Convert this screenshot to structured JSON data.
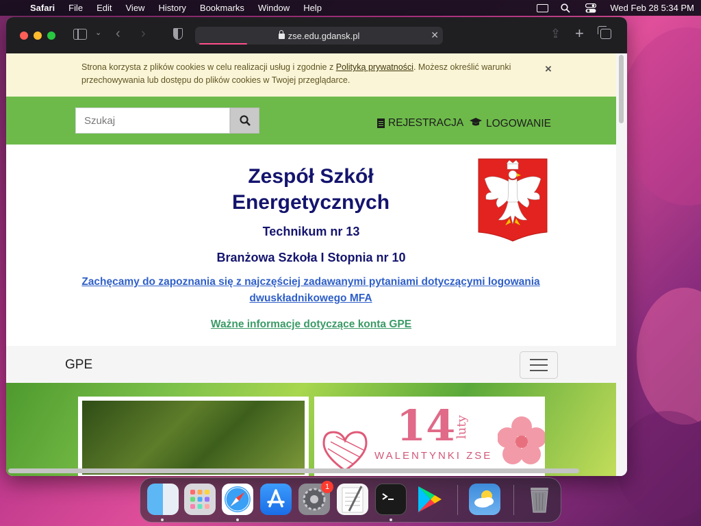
{
  "menubar": {
    "app_name": "Safari",
    "items": [
      "File",
      "Edit",
      "View",
      "History",
      "Bookmarks",
      "Window",
      "Help"
    ],
    "datetime": "Wed Feb 28  5:34 PM"
  },
  "browser": {
    "url": "zse.edu.gdansk.pl"
  },
  "cookie_banner": {
    "text_before": "Strona korzysta z plików cookies w celu realizacji usług i zgodnie z ",
    "link": "Polityką prywatności",
    "text_after": ". Możesz określić warunki przechowywania lub dostępu do plików cookies w Twojej przeglądarce.",
    "close": "×"
  },
  "topbar": {
    "search_placeholder": "Szukaj",
    "register": "REJESTRACJA",
    "login": "LOGOWANIE"
  },
  "header": {
    "title_line1": "Zespół Szkół",
    "title_line2": "Energetycznych",
    "subtitle1": "Technikum nr 13",
    "subtitle2": "Branżowa Szkoła I Stopnia nr 10",
    "mfa_link": "Zachęcamy do zapoznania się z najczęściej zadawanymi pytaniami dotyczącymi logowania dwuskładnikowego MFA",
    "gpe_link": "Ważne informacje dotyczące konta GPE"
  },
  "navbar": {
    "brand": "GPE"
  },
  "slider": {
    "card2_number": "14",
    "card2_month": "luty",
    "card2_caption": "WALENTYNKI ZSE"
  },
  "dock": {
    "settings_badge": "1"
  },
  "colors": {
    "green_bar": "#6dba4a",
    "title_navy": "#14146e",
    "link_blue": "#2f5fc8",
    "link_green": "#3a9a66",
    "cookie_bg": "#fbf5d8"
  }
}
